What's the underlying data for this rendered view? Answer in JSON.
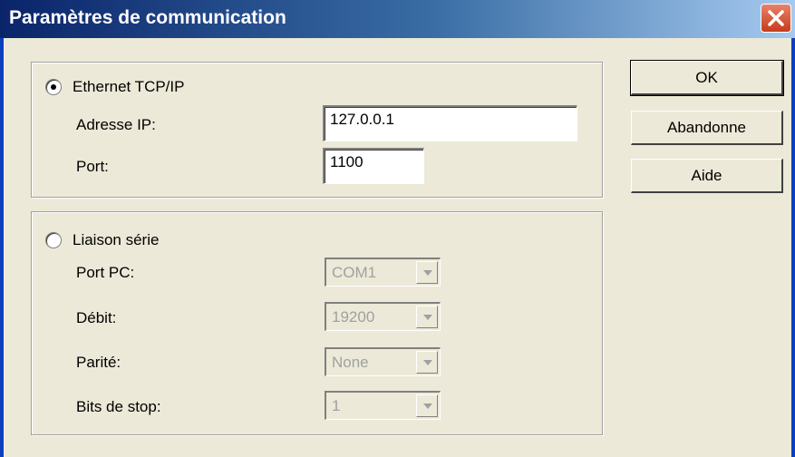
{
  "window": {
    "title": "Paramètres de communication"
  },
  "ethernet": {
    "label": "Ethernet TCP/IP",
    "selected": true,
    "ip_label": "Adresse IP:",
    "ip_value": "127.0.0.1",
    "port_label": "Port:",
    "port_value": "1100"
  },
  "serial": {
    "label": "Liaison série",
    "selected": false,
    "port_pc_label": "Port PC:",
    "port_pc_value": "COM1",
    "baud_label": "Débit:",
    "baud_value": "19200",
    "parity_label": "Parité:",
    "parity_value": "None",
    "stop_bits_label": "Bits de stop:",
    "stop_bits_value": "1"
  },
  "buttons": {
    "ok": "OK",
    "cancel": "Abandonne",
    "help": "Aide"
  },
  "icons": {
    "close": "close-icon",
    "dropdown": "chevron-down-icon"
  }
}
